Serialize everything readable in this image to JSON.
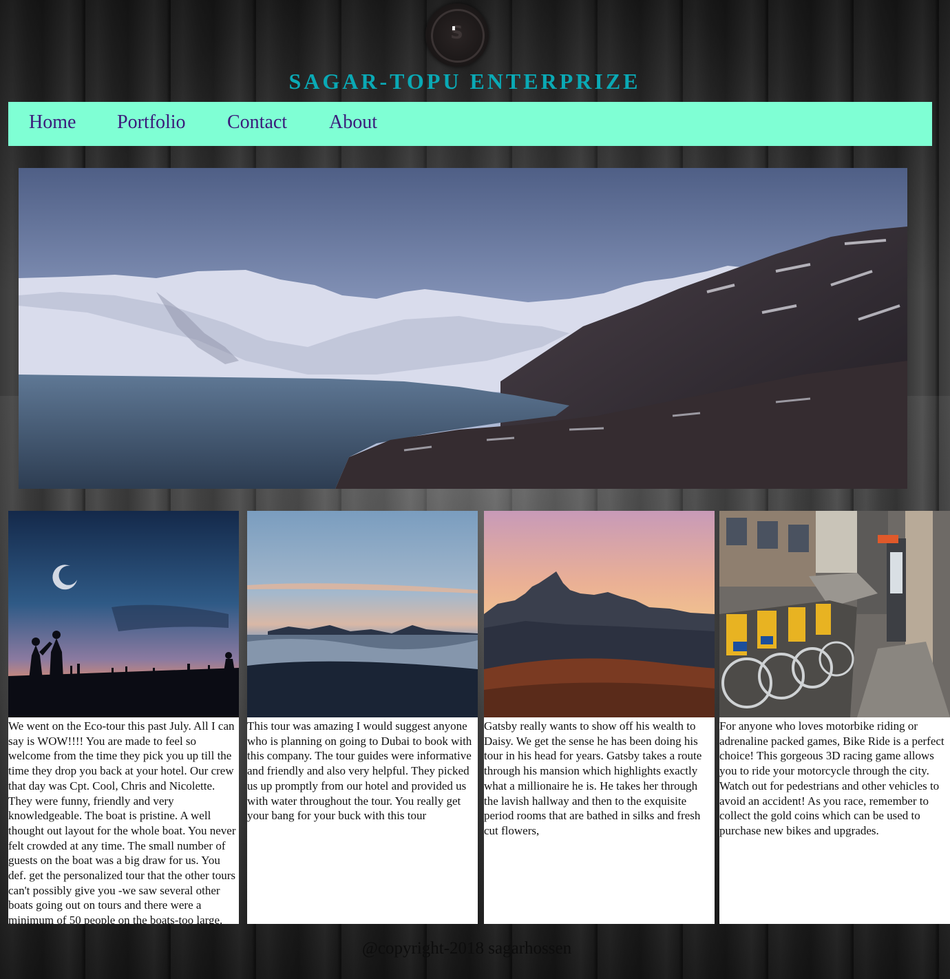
{
  "header": {
    "logo_text": "S",
    "site_title": "SAGAR-TOPU ENTERPRIZE"
  },
  "nav": {
    "items": [
      {
        "label": "Home"
      },
      {
        "label": "Portfolio"
      },
      {
        "label": "Contact"
      },
      {
        "label": "About"
      }
    ]
  },
  "cards": [
    {
      "text": "We went on the Eco-tour this past July. All I can say is WOW!!!! You are made to feel so welcome from the time they pick you up till the time they drop you back at your hotel. Our crew that day was Cpt. Cool, Chris and Nicolette. They were funny, friendly and very knowledgeable. The boat is pristine. A well thought out layout for the whole boat. You never felt crowded at any time. The small number of guests on the boat was a big draw for us. You def. get the personalized tour that the other tours can't possibly give you -we saw several other boats going out on tours and there were a minimum of 50 people on the boats-too large."
    },
    {
      "text": "This tour was amazing I would suggest anyone who is planning on going to Dubai to book with this company. The tour guides were informative and friendly and also very helpful. They picked us up promptly from our hotel and provided us with water throughout the tour. You really get your bang for your buck with this tour"
    },
    {
      "text": "Gatsby really wants to show off his wealth to Daisy. We get the sense he has been doing his tour in his head for years. Gatsby takes a route through his mansion which highlights exactly what a millionaire he is. He takes her through the lavish hallway and then to the exquisite period rooms that are bathed in silks and fresh cut flowers,"
    },
    {
      "text": "For anyone who loves motorbike riding or adrenaline packed games, Bike Ride is a perfect choice! This gorgeous 3D racing game allows you to ride your motorcycle through the city. Watch out for pedestrians and other vehicles to avoid an accident! As you race, remember to collect the gold coins which can be used to purchase new bikes and upgrades."
    }
  ],
  "footer": {
    "text": "@copyright-2018 sagarhossen"
  },
  "colors": {
    "title": "#0aa9b5",
    "navbar_bg": "#7fffd4",
    "nav_link": "#3b1a7a"
  }
}
